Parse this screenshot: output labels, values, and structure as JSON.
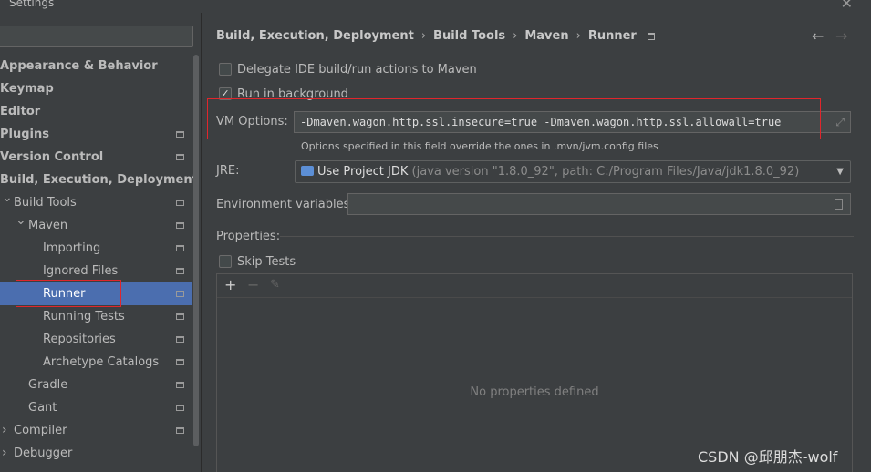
{
  "window": {
    "title": "Settings"
  },
  "sidebar": {
    "search_placeholder": "",
    "items": [
      {
        "label": "Appearance & Behavior",
        "bold": true,
        "indent": 0,
        "arrow": "",
        "icon": false
      },
      {
        "label": "Keymap",
        "bold": true,
        "indent": 0,
        "arrow": "",
        "icon": false
      },
      {
        "label": "Editor",
        "bold": true,
        "indent": 0,
        "arrow": "",
        "icon": false
      },
      {
        "label": "Plugins",
        "bold": true,
        "indent": 0,
        "arrow": "",
        "icon": true
      },
      {
        "label": "Version Control",
        "bold": true,
        "indent": 0,
        "arrow": "",
        "icon": true
      },
      {
        "label": "Build, Execution, Deployment",
        "bold": true,
        "indent": 0,
        "arrow": "",
        "icon": false
      },
      {
        "label": "Build Tools",
        "bold": false,
        "indent": 1,
        "arrow": "v",
        "icon": true
      },
      {
        "label": "Maven",
        "bold": false,
        "indent": 2,
        "arrow": "v",
        "icon": true
      },
      {
        "label": "Importing",
        "bold": false,
        "indent": 3,
        "arrow": "",
        "icon": true
      },
      {
        "label": "Ignored Files",
        "bold": false,
        "indent": 3,
        "arrow": "",
        "icon": true
      },
      {
        "label": "Runner",
        "bold": false,
        "indent": 3,
        "arrow": "",
        "icon": true,
        "selected": true
      },
      {
        "label": "Running Tests",
        "bold": false,
        "indent": 3,
        "arrow": "",
        "icon": true
      },
      {
        "label": "Repositories",
        "bold": false,
        "indent": 3,
        "arrow": "",
        "icon": true
      },
      {
        "label": "Archetype Catalogs",
        "bold": false,
        "indent": 3,
        "arrow": "",
        "icon": true
      },
      {
        "label": "Gradle",
        "bold": false,
        "indent": 2,
        "arrow": "",
        "icon": true
      },
      {
        "label": "Gant",
        "bold": false,
        "indent": 2,
        "arrow": "",
        "icon": true
      },
      {
        "label": "Compiler",
        "bold": false,
        "indent": 1,
        "arrow": ">",
        "icon": true
      },
      {
        "label": "Debugger",
        "bold": false,
        "indent": 1,
        "arrow": ">",
        "icon": false
      }
    ]
  },
  "breadcrumb": {
    "items": [
      "Build, Execution, Deployment",
      "Build Tools",
      "Maven",
      "Runner"
    ],
    "separator": "›"
  },
  "nav": {
    "back": "←",
    "forward": "→"
  },
  "options": {
    "delegate_label": "Delegate IDE build/run actions to Maven",
    "delegate_checked": false,
    "background_label": "Run in background",
    "background_checked": true
  },
  "vm_options": {
    "label": "VM Options:",
    "value": "-Dmaven.wagon.http.ssl.insecure=true -Dmaven.wagon.http.ssl.allowall=true",
    "hint": "Options specified in this field override the ones in .mvn/jvm.config files"
  },
  "jre": {
    "label": "JRE:",
    "selected": "Use Project JDK",
    "detail": " (java version \"1.8.0_92\", path: C:/Program Files/Java/jdk1.8.0_92)"
  },
  "env": {
    "label": "Environment variables:",
    "value": ""
  },
  "properties": {
    "title": "Properties:",
    "skip_tests_label": "Skip Tests",
    "skip_tests_checked": false,
    "add": "+",
    "remove": "−",
    "empty_text": "No properties defined"
  },
  "watermark": "CSDN @邱朋杰-wolf",
  "colors": {
    "background": "#3c3f41",
    "selection": "#4b6eaf",
    "annotation_red": "#e0262c"
  }
}
